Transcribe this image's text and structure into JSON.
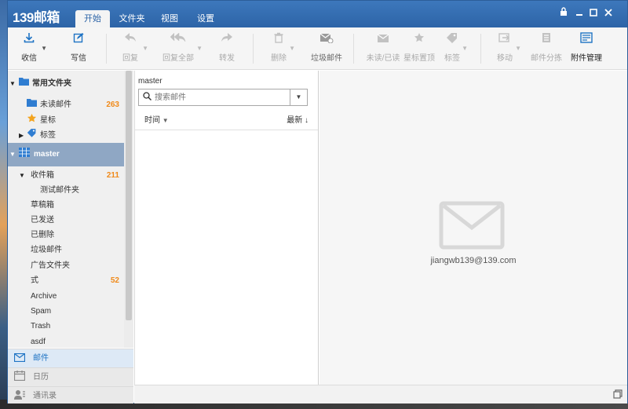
{
  "app": {
    "logo": "139邮箱",
    "tabs": [
      {
        "label": "开始",
        "active": true
      },
      {
        "label": "文件夹",
        "active": false
      },
      {
        "label": "视图",
        "active": false
      },
      {
        "label": "设置",
        "active": false
      }
    ],
    "window_controls": {
      "lock": "lock-icon",
      "minimize": "minimize-icon",
      "maximize": "maximize-icon",
      "close": "close-icon"
    },
    "accent": "#2d64a7"
  },
  "ribbon": {
    "receive": "收信",
    "compose": "写信",
    "reply": "回复",
    "reply_all": "回复全部",
    "forward": "转发",
    "delete": "删除",
    "junk": "垃圾邮件",
    "unread_read": "未读/已读",
    "star_top": "星标置顶",
    "tag": "标签",
    "move": "移动",
    "sort_mail": "邮件分拣",
    "attachments": "附件管理"
  },
  "folders": {
    "common_group": "常用文件夹",
    "unread": "未读邮件",
    "unread_count": "263",
    "starred": "星标",
    "tags": "标签",
    "account": "master",
    "inbox": "收件箱",
    "inbox_count": "211",
    "test_folder": "测试邮件夹",
    "drafts": "草稿箱",
    "sent": "已发送",
    "deleted": "已删除",
    "junk": "垃圾邮件",
    "ads": "广告文件夹",
    "shi": "式",
    "shi_count": "52",
    "archive": "Archive",
    "spam": "Spam",
    "trash": "Trash",
    "asdf": "asdf"
  },
  "nav": {
    "mail": "邮件",
    "calendar": "日历",
    "contacts": "通讯录"
  },
  "list": {
    "account_label": "master",
    "search_placeholder": "搜索邮件",
    "sort_field": "时间",
    "sort_order": "最新"
  },
  "preview": {
    "email": "jiangwb139@139.com"
  }
}
